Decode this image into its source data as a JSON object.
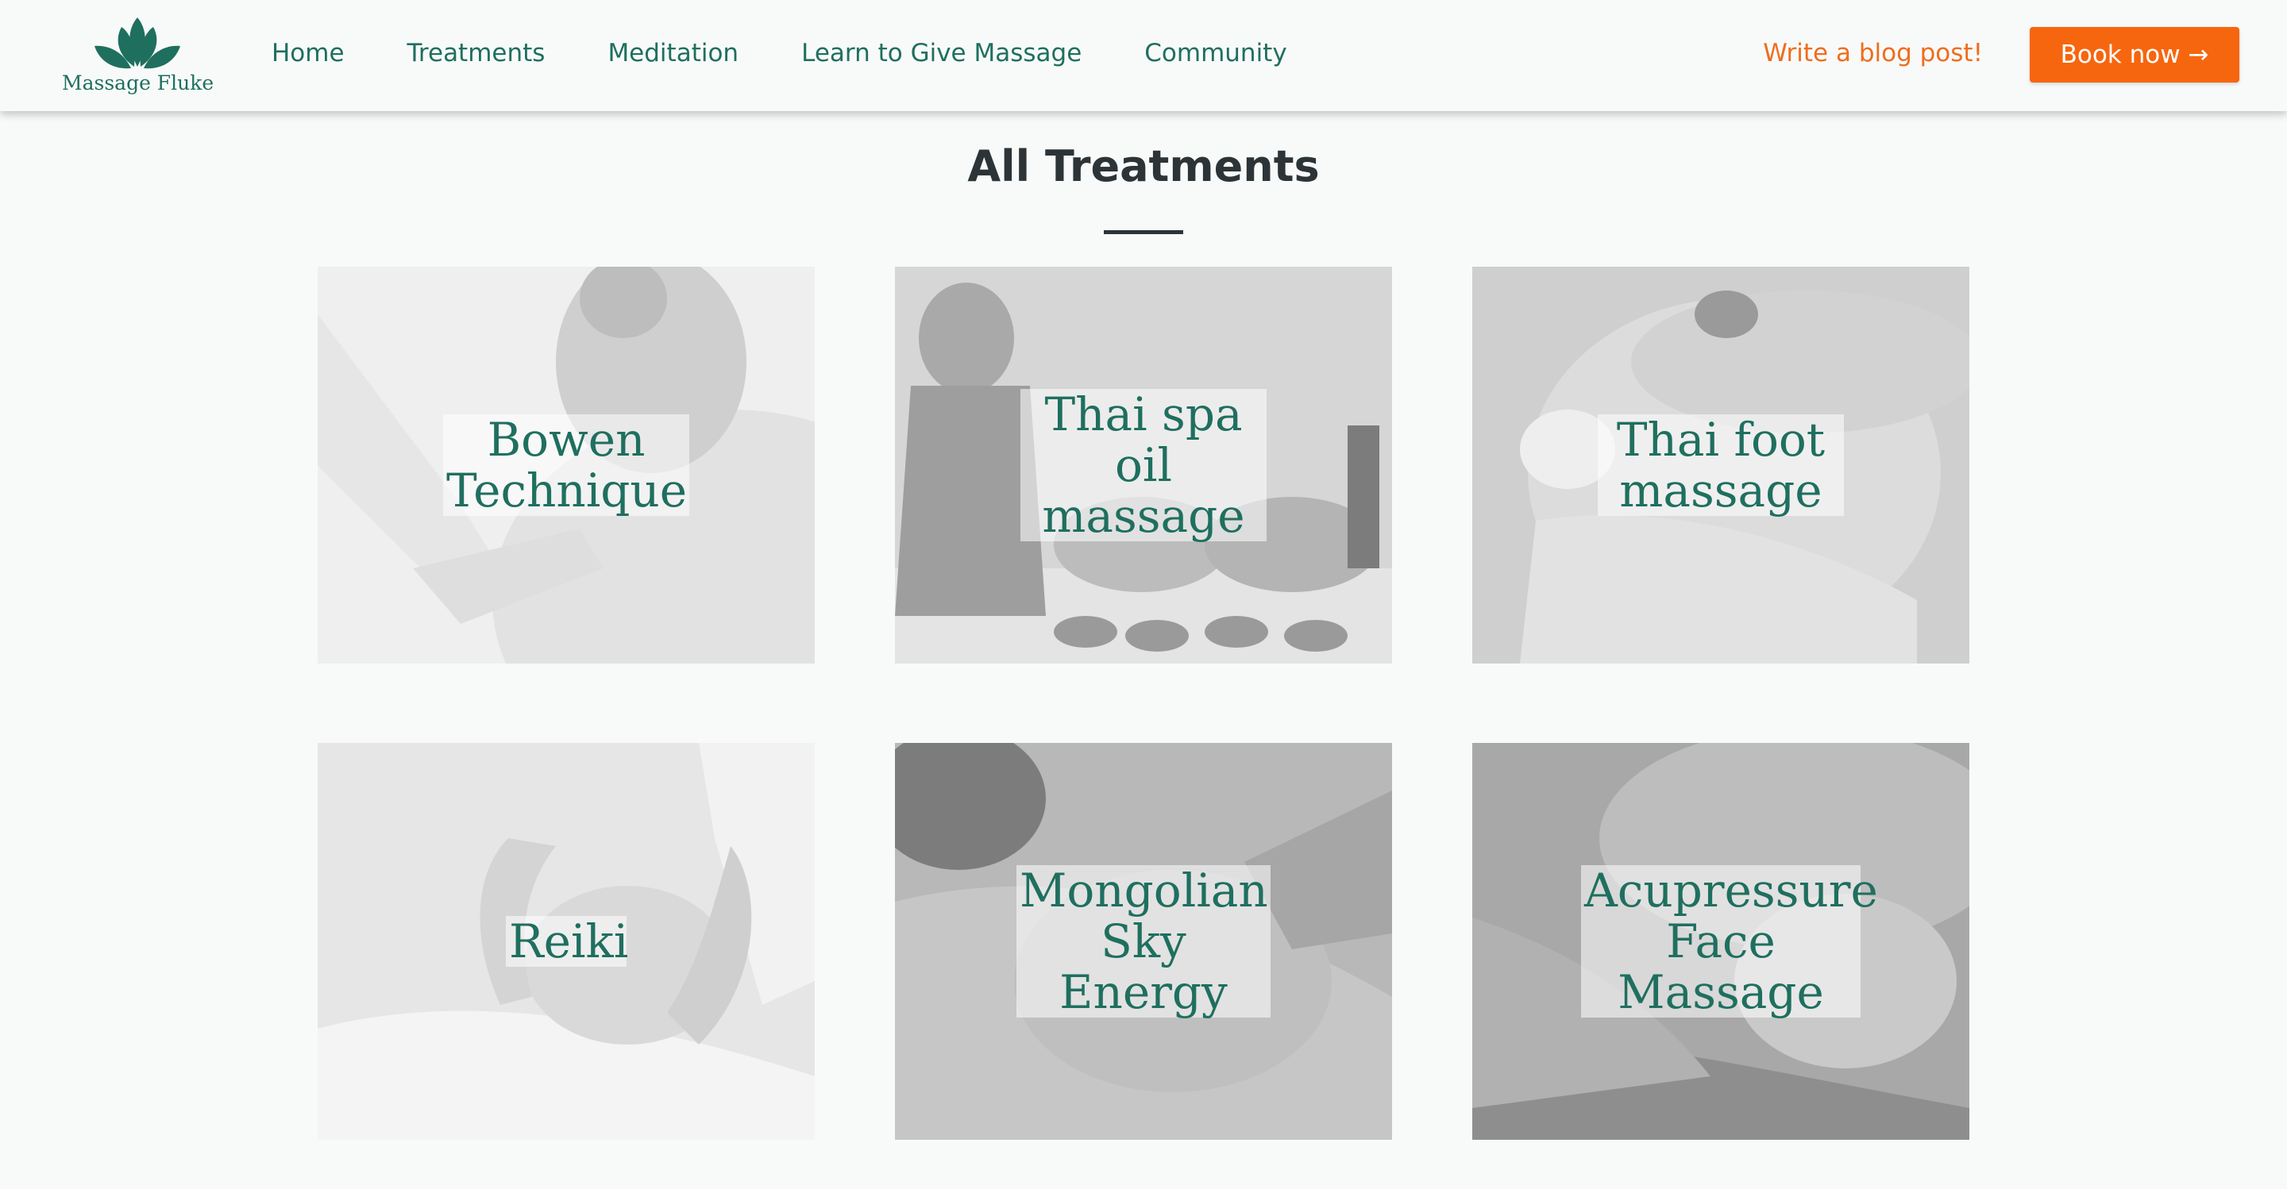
{
  "header": {
    "brand": "Massage Fluke",
    "logo_icon": "lotus-icon",
    "nav": [
      {
        "label": "Home"
      },
      {
        "label": "Treatments"
      },
      {
        "label": "Meditation"
      },
      {
        "label": "Learn to Give Massage"
      },
      {
        "label": "Community"
      }
    ],
    "blog_link": "Write a blog post!",
    "book_button": "Book now →"
  },
  "main": {
    "title": "All Treatments",
    "treatments": [
      {
        "name": "Bowen Technique"
      },
      {
        "name": "Thai spa oil massage"
      },
      {
        "name": "Thai foot massage"
      },
      {
        "name": "Reiki"
      },
      {
        "name": "Mongolian Sky Energy"
      },
      {
        "name": "Acupressure Face Massage"
      }
    ]
  },
  "colors": {
    "brand_green": "#1f6f5f",
    "accent_orange": "#f6660e",
    "heading": "#2d3437",
    "background": "#f8faf9"
  }
}
